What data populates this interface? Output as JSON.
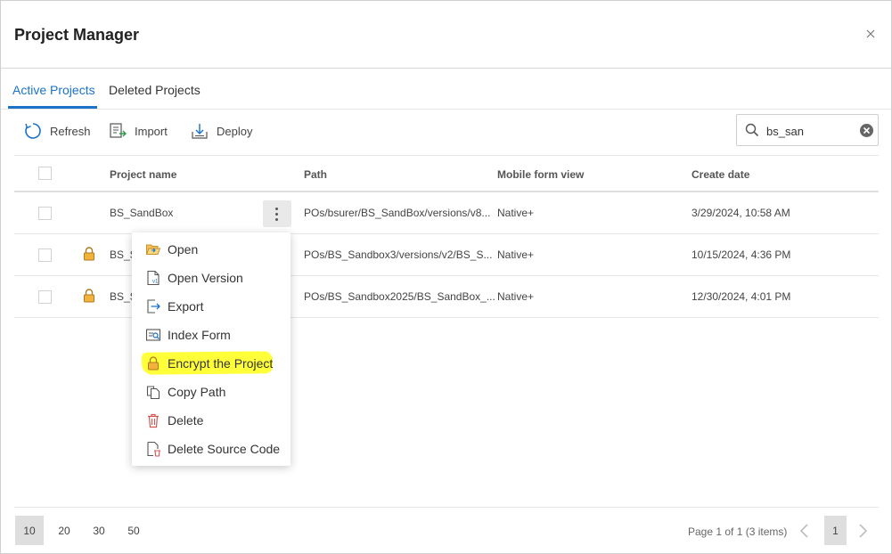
{
  "dialog": {
    "title": "Project Manager"
  },
  "tabs": [
    {
      "label": "Active Projects",
      "active": true
    },
    {
      "label": "Deleted Projects",
      "active": false
    }
  ],
  "toolbar": {
    "refresh_label": "Refresh",
    "import_label": "Import",
    "deploy_label": "Deploy",
    "search_value": "bs_san"
  },
  "table": {
    "columns": [
      "Project name",
      "Path",
      "Mobile form view",
      "Create date"
    ],
    "rows": [
      {
        "name": "BS_SandBox",
        "locked": false,
        "path": "POs/bsurer/BS_SandBox/versions/v8...",
        "mobile_view": "Native+",
        "create_date": "3/29/2024, 10:58 AM"
      },
      {
        "name": "BS_S",
        "locked": true,
        "path": "POs/BS_Sandbox3/versions/v2/BS_S...",
        "mobile_view": "Native+",
        "create_date": "10/15/2024, 4:36 PM"
      },
      {
        "name": "BS_S",
        "locked": true,
        "path": "POs/BS_Sandbox2025/BS_SandBox_...",
        "mobile_view": "Native+",
        "create_date": "12/30/2024, 4:01 PM"
      }
    ]
  },
  "context_menu": {
    "items": [
      {
        "label": "Open",
        "icon": "folder-open-icon"
      },
      {
        "label": "Open Version",
        "icon": "file-version-icon"
      },
      {
        "label": "Export",
        "icon": "export-icon"
      },
      {
        "label": "Index Form",
        "icon": "index-form-icon"
      },
      {
        "label": "Encrypt the Project",
        "icon": "lock-icon",
        "highlighted": true
      },
      {
        "label": "Copy Path",
        "icon": "copy-icon"
      },
      {
        "label": "Delete",
        "icon": "trash-icon"
      },
      {
        "label": "Delete Source Code",
        "icon": "delete-file-icon"
      }
    ]
  },
  "footer": {
    "page_sizes": [
      "10",
      "20",
      "30",
      "50"
    ],
    "selected_page_size": "10",
    "page_info": "Page 1 of 1 (3 items)",
    "current_page": "1"
  },
  "colors": {
    "accent": "#1a73c8",
    "highlight": "#ffff3a",
    "lock": "#e8a33a",
    "delete": "#d9534f"
  }
}
